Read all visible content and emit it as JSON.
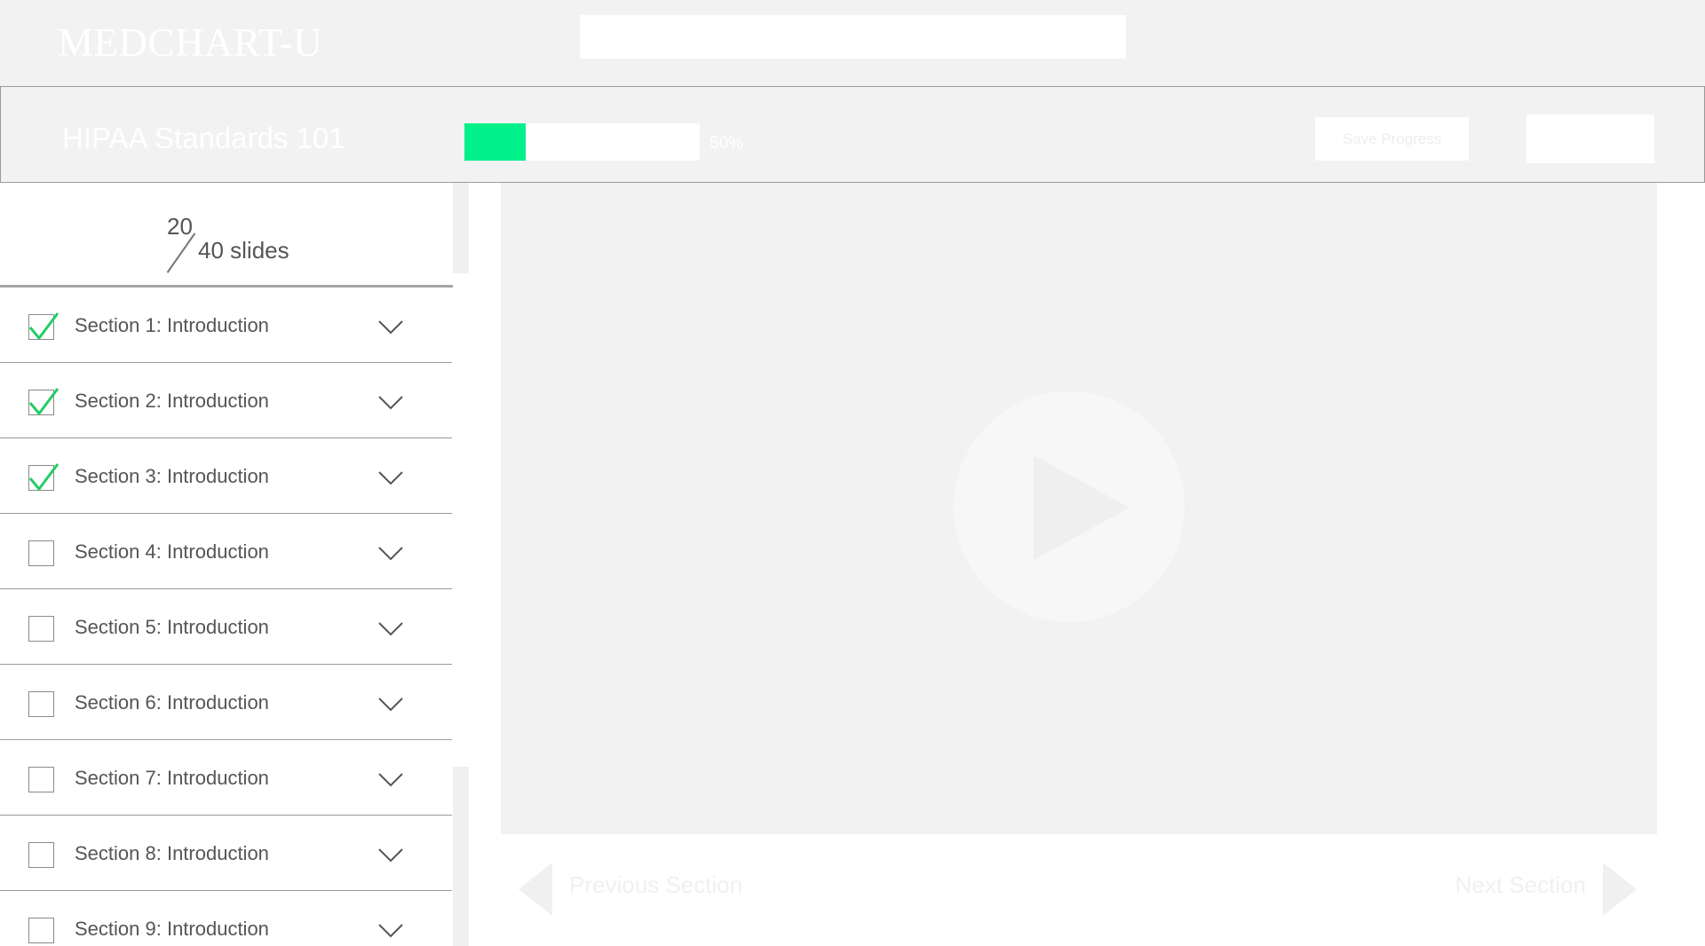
{
  "app": {
    "logo_text": "MEDCHART-U",
    "search_placeholder": ""
  },
  "course": {
    "title": "HIPAA Standards 101",
    "progress_percent": 50,
    "progress_label": "50%",
    "save_label": "Save Progress",
    "colors": {
      "progress_fill": "#00f08a",
      "check": "#22cc66"
    }
  },
  "sidebar": {
    "slides_current": "20",
    "slides_total": "40 slides",
    "sections": [
      {
        "label": "Section 1: Introduction",
        "completed": true
      },
      {
        "label": "Section 2: Introduction",
        "completed": true
      },
      {
        "label": "Section 3: Introduction",
        "completed": true
      },
      {
        "label": "Section 4: Introduction",
        "completed": false
      },
      {
        "label": "Section 5: Introduction",
        "completed": false
      },
      {
        "label": "Section 6: Introduction",
        "completed": false
      },
      {
        "label": "Section 7: Introduction",
        "completed": false
      },
      {
        "label": "Section 8: Introduction",
        "completed": false
      },
      {
        "label": "Section 9: Introduction",
        "completed": false
      }
    ]
  },
  "player": {
    "icon": "play-icon"
  },
  "navigation": {
    "prev_label": "Previous Section",
    "next_label": "Next Section"
  }
}
